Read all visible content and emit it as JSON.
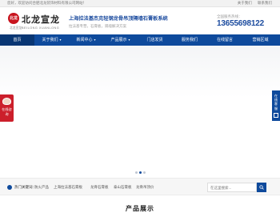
{
  "topbar": {
    "welcome": "您好，欢迎访问合肥北龙装饰材料有限公司网站！",
    "links": [
      "关于我们",
      "联系我们"
    ]
  },
  "logo": {
    "seal": "北龙",
    "name": "北龙宣龙",
    "sub": "北龙宣龙",
    "en": "BEILONG XUANLONG"
  },
  "header": {
    "slogan": "上海拉法基杰克轻钢龙骨吊顶隔墙石膏板系统",
    "slogan2": "拉法基专营，石膏板，隔墙解决方案",
    "hotline_label": "全国服务热线：",
    "hotline": "13655698122"
  },
  "nav": {
    "items": [
      {
        "label": "首页",
        "caret": ""
      },
      {
        "label": "关于我们",
        "caret": "▾"
      },
      {
        "label": "新闻中心",
        "caret": "▾"
      },
      {
        "label": "产品展示",
        "caret": "▾"
      },
      {
        "label": "门店发货",
        "caret": ""
      },
      {
        "label": "服务我们",
        "caret": ""
      },
      {
        "label": "在线留言",
        "caret": ""
      },
      {
        "label": "营销区域",
        "caret": ""
      }
    ]
  },
  "float_left": {
    "text": "在线咨询"
  },
  "float_right": {
    "text": "在线客服"
  },
  "hotbar": {
    "label": "热门关键词：",
    "items": [
      "防火产品",
      "上海拉法基石膏板",
      "龙骨石膏板",
      "泰山石膏板",
      "龙骨吊顶价"
    ],
    "search_placeholder": "在这里搜索..."
  },
  "section": {
    "title": "产品展示"
  },
  "colors": {
    "primary": "#0e4a9c",
    "accent": "#cc1f2b"
  }
}
